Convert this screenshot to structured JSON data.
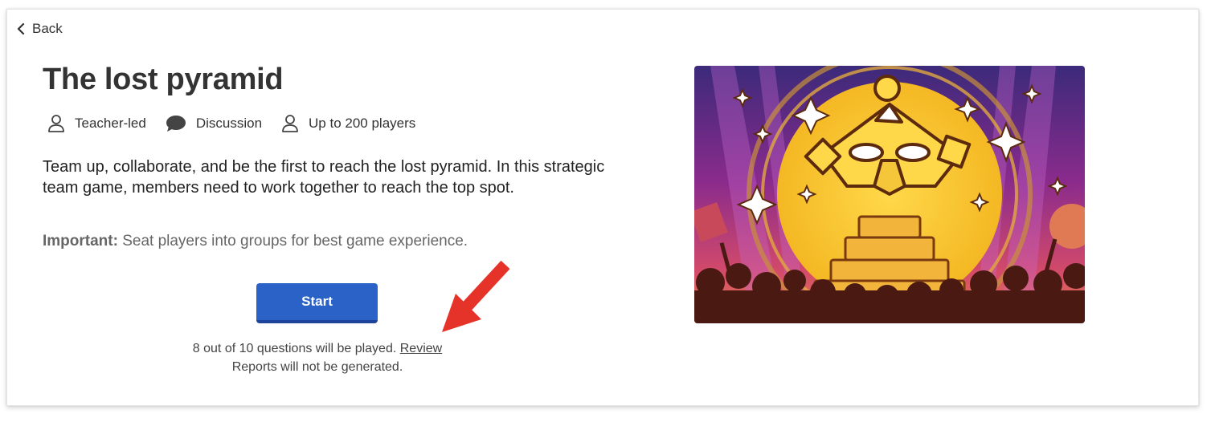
{
  "nav": {
    "back_label": "Back"
  },
  "game": {
    "title": "The lost pyramid",
    "meta": [
      {
        "icon": "person-icon",
        "label": "Teacher-led"
      },
      {
        "icon": "speech-bubble-icon",
        "label": "Discussion"
      },
      {
        "icon": "person-icon",
        "label": "Up to 200 players"
      }
    ],
    "description": "Team up, collaborate, and be the first to reach the lost pyramid. In this strategic team game, members need to work together to reach the top spot.",
    "important_label": "Important:",
    "important_text": " Seat players into groups for best game experience."
  },
  "actions": {
    "start_label": "Start",
    "questions_text": "8 out of 10 questions will be played.",
    "review_link": "Review",
    "reports_text": "Reports will not be generated."
  },
  "colors": {
    "primary_button": "#2b62c7",
    "annotation_arrow": "#e5332a",
    "art_purple": "#4b2a86",
    "art_yellow": "#f7c730"
  }
}
